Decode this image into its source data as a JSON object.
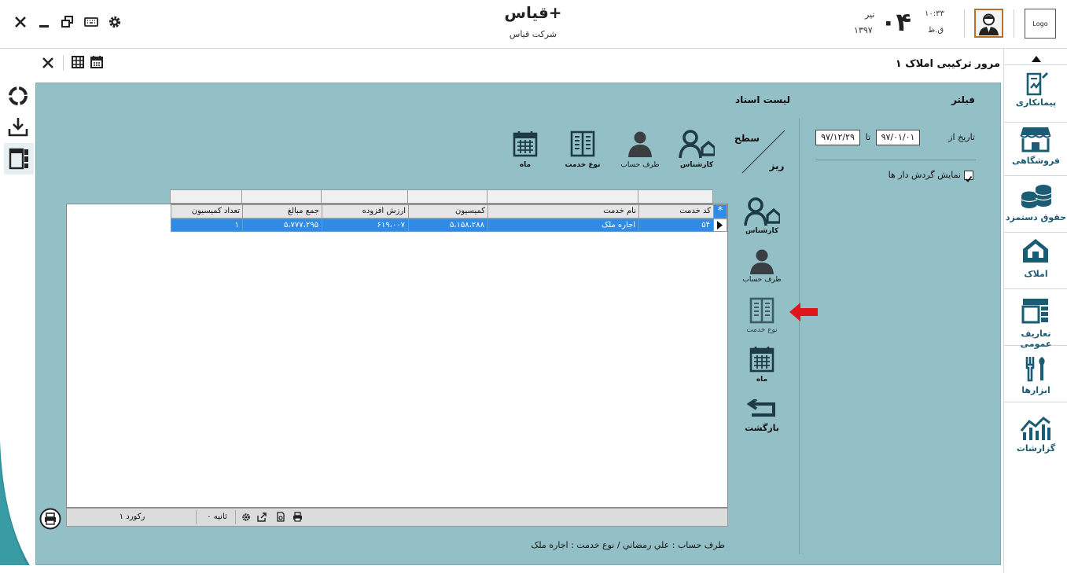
{
  "app": {
    "title": "قیاس+",
    "company": "شرکت قیاس"
  },
  "clock": {
    "time": "۱۰:۳۳",
    "ampm": "ق.ظ",
    "day": "۰۴",
    "month": "تیر",
    "year": "۱۳۹۷"
  },
  "logo": {
    "text": "Logo"
  },
  "document": {
    "title": "مرور ترکیبی املاک ۱"
  },
  "filter": {
    "title": "فیلتر",
    "date_from_label": "تاریخ از",
    "date_from": "۹۷/۰۱/۰۱",
    "date_to_label": "تا",
    "date_to": "۹۷/۱۲/۲۹",
    "show_turnover_label": "نمایش گردش دار ها",
    "show_turnover_checked": true
  },
  "list": {
    "title": "لیست اسناد"
  },
  "level": {
    "top_label": "سطح",
    "bottom_label": "ریز"
  },
  "top_tools": [
    {
      "label": "کارشناس"
    },
    {
      "label": "طرف حساب"
    },
    {
      "label": "نوع خدمت"
    },
    {
      "label": "ماه"
    }
  ],
  "side_tools": [
    {
      "label": "کارشناس"
    },
    {
      "label": "طرف حساب"
    },
    {
      "label": "نوع خدمت"
    },
    {
      "label": "ماه"
    },
    {
      "label": "بازگشت"
    }
  ],
  "grid": {
    "columns": [
      "کد خدمت",
      "نام خدمت",
      "کمیسیون",
      "ارزش افزوده",
      "جمع مبالغ",
      "تعداد کمیسیون"
    ],
    "rows": [
      [
        "۵۴",
        "اجاره ملک",
        "۵،۱۵۸،۲۸۸",
        "۶۱۹،۰۰۷",
        "۵،۷۷۷،۲۹۵",
        "۱"
      ]
    ],
    "new_row_marker": "*",
    "footer": {
      "record_count": "۱ رکورد",
      "timer": "۰ ثانیه"
    }
  },
  "summary": "طرف حساب : علي رمضاني / نوع خدمت : اجاره ملک",
  "nav": [
    {
      "label": "پیمانکاری"
    },
    {
      "label": "فروشگاهی"
    },
    {
      "label": "حقوق دستمزد"
    },
    {
      "label": "املاک"
    },
    {
      "label": "تعاریف عمومی"
    },
    {
      "label": "ابزارها"
    },
    {
      "label": "گزارشات"
    }
  ],
  "colors": {
    "panel": "#93c0c6",
    "nav_text": "#1a5c73",
    "selection": "#2f8be6",
    "arrow": "#e0141b",
    "icon_dark": "#1f3a47"
  }
}
